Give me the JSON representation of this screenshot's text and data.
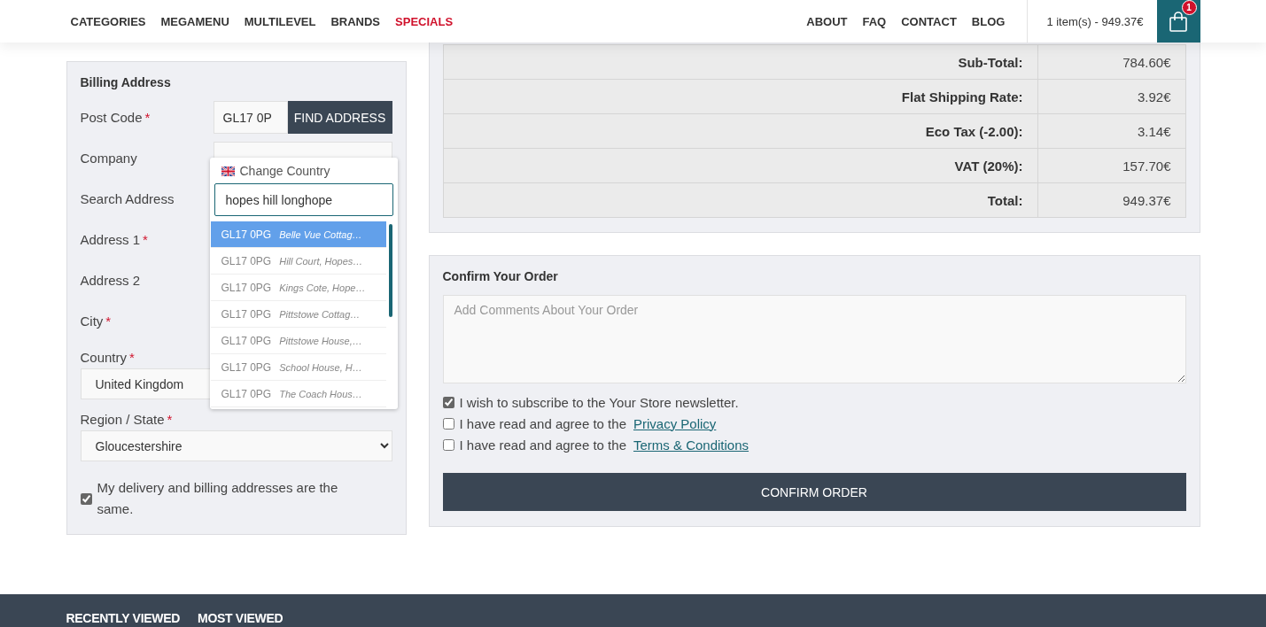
{
  "nav": {
    "left_links": [
      {
        "label": "CATEGORIES",
        "highlighted": false
      },
      {
        "label": "MEGAMENU",
        "highlighted": false
      },
      {
        "label": "MULTILEVEL",
        "highlighted": false
      },
      {
        "label": "BRANDS",
        "highlighted": false
      },
      {
        "label": "SPECIALS",
        "highlighted": true
      }
    ],
    "right_links": [
      "ABOUT",
      "FAQ",
      "CONTACT",
      "BLOG"
    ],
    "cart": {
      "summary": "1 item(s) - 949.37€",
      "badge": "1"
    }
  },
  "billing": {
    "title": "Billing Address",
    "fields": [
      {
        "kind": "postcode",
        "label": "Post Code",
        "mark": "*",
        "value": "GL17 0P",
        "button": "FIND ADDRESS"
      },
      {
        "kind": "text",
        "label": "Company"
      },
      {
        "kind": "covered",
        "label": "Search Address"
      },
      {
        "kind": "covered",
        "label": "Address 1",
        "mark": "*"
      },
      {
        "kind": "covered",
        "label": "Address 2"
      },
      {
        "kind": "covered",
        "label": "City",
        "mark": "*"
      },
      {
        "kind": "select",
        "label": "Country",
        "mark": "*",
        "value": "United Kingdom"
      },
      {
        "kind": "select",
        "label": "Region / State",
        "mark": "*",
        "value": "Gloucestershire"
      }
    ],
    "same_address": {
      "label": "My delivery and billing addresses are the same.",
      "checked": true
    }
  },
  "address_lookup": {
    "title": "Change Country",
    "query": "hopes hill longhope",
    "results": [
      {
        "postcode": "GL17 0PG",
        "address": "Belle Vue Cottag…",
        "selected": true
      },
      {
        "postcode": "GL17 0PG",
        "address": "Hill Court, Hopes…",
        "selected": false
      },
      {
        "postcode": "GL17 0PG",
        "address": "Kings Cote, Hope…",
        "selected": false
      },
      {
        "postcode": "GL17 0PG",
        "address": "Pittstowe Cottag…",
        "selected": false
      },
      {
        "postcode": "GL17 0PG",
        "address": "Pittstowe House,…",
        "selected": false
      },
      {
        "postcode": "GL17 0PG",
        "address": "School House, H…",
        "selected": false
      },
      {
        "postcode": "GL17 0PG",
        "address": "The Coach Hous…",
        "selected": false
      }
    ]
  },
  "totals": [
    {
      "label": "Sub-Total:",
      "value": "784.60€"
    },
    {
      "label": "Flat Shipping Rate:",
      "value": "3.92€"
    },
    {
      "label": "Eco Tax (-2.00):",
      "value": "3.14€"
    },
    {
      "label": "VAT (20%):",
      "value": "157.70€"
    },
    {
      "label": "Total:",
      "value": "949.37€"
    }
  ],
  "confirm": {
    "title": "Confirm Your Order",
    "comment_placeholder": "Add Comments About Your Order",
    "options": [
      {
        "text": "I wish to subscribe to the Your Store newsletter.",
        "checked": true
      },
      {
        "text": "I have read and agree to the",
        "link": "Privacy Policy",
        "checked": false
      },
      {
        "text": "I have read and agree to the",
        "link": "Terms & Conditions",
        "checked": false
      }
    ],
    "button": "CONFIRM ORDER"
  },
  "footer": {
    "tabs": [
      "RECENTLY VIEWED",
      "MOST VIEWED"
    ]
  }
}
